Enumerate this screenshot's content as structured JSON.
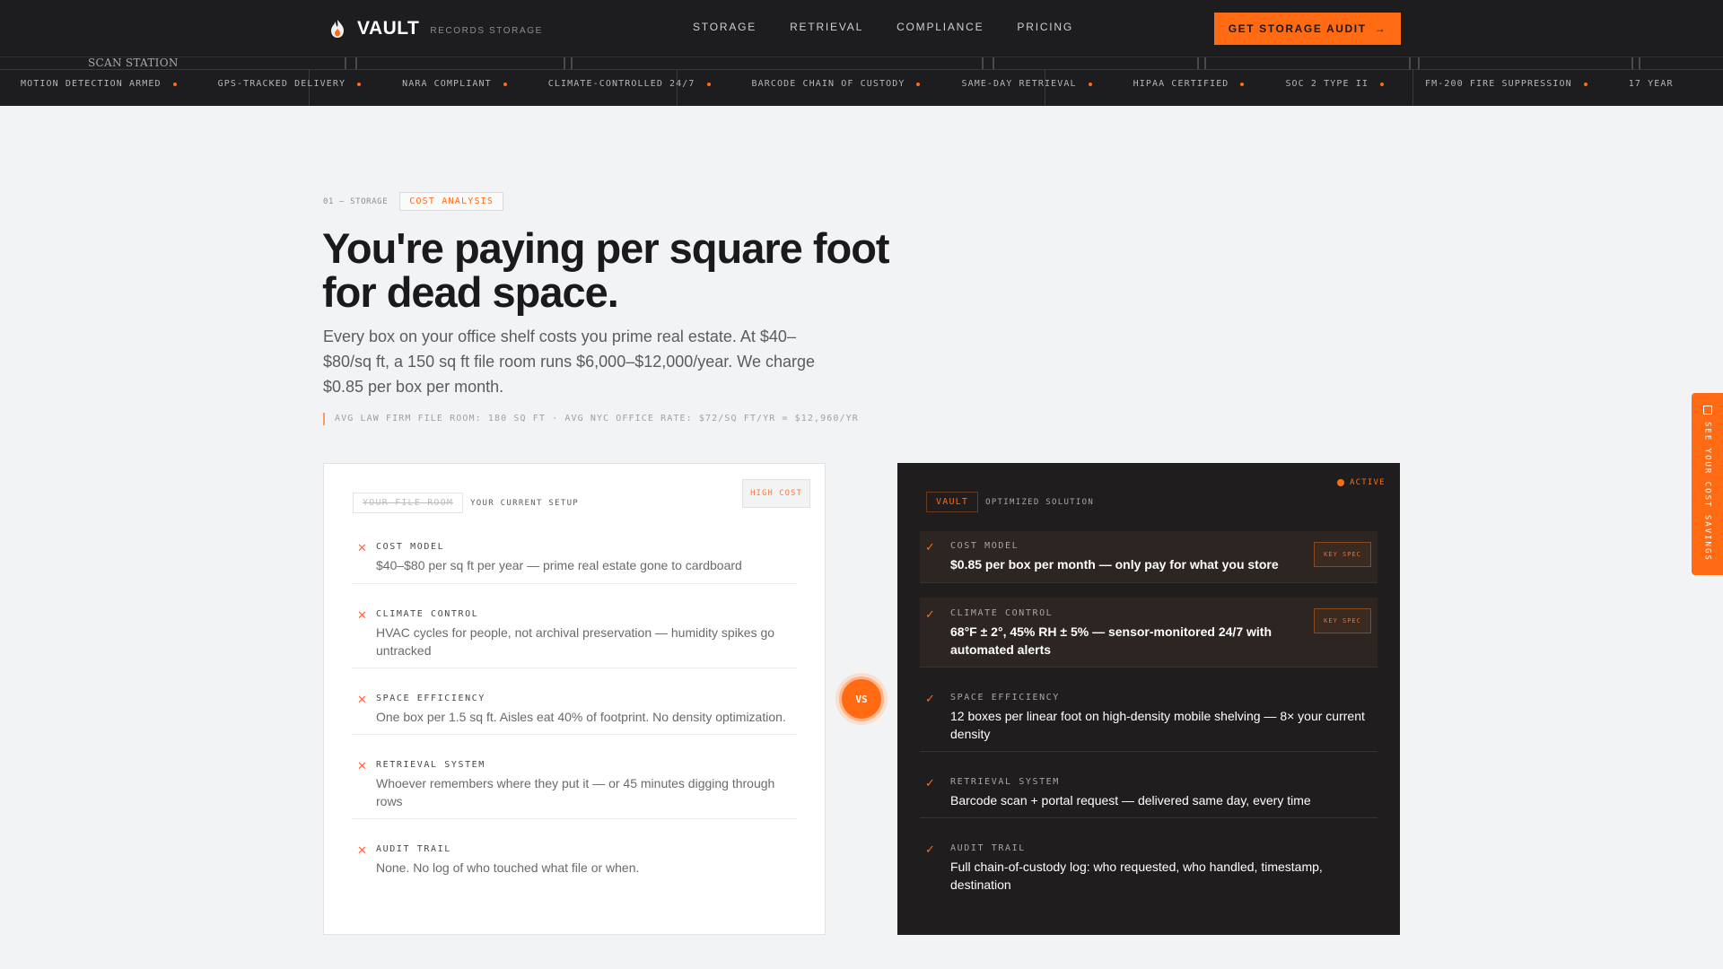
{
  "nav": {
    "logo_text": "VAULT",
    "logo_sub": "RECORDS STORAGE",
    "links": [
      "STORAGE",
      "RETRIEVAL",
      "COMPLIANCE",
      "PRICING"
    ],
    "cta_label": "GET STORAGE AUDIT",
    "cta_arrow": "→",
    "accent": "#ff6a13"
  },
  "ticker": {
    "scan_label": "SCAN STATION",
    "items": [
      "MOTION DETECTION ARMED",
      "GPS-TRACKED DELIVERY",
      "NARA COMPLIANT",
      "CLIMATE-CONTROLLED 24/7",
      "BARCODE CHAIN OF CUSTODY",
      "SAME-DAY RETRIEVAL",
      "HIPAA CERTIFIED",
      "SOC 2 TYPE II",
      "FM-200 FIRE SUPPRESSION",
      "17 YEAR"
    ]
  },
  "hero": {
    "section": "01 — STORAGE",
    "tag": "COST ANALYSIS",
    "title_line1": "You're paying per square foot",
    "title_line2": "for dead space.",
    "lead": "Every box on your office shelf costs you prime real estate. At $40–$80/sq ft, a 150 sq ft file room runs $6,000–$12,000/year. We charge $0.85 per box per month.",
    "stat": "AVG LAW FIRM FILE ROOM: 180 SQ FT · AVG NYC OFFICE RATE: $72/SQ FT/YR = $12,960/YR"
  },
  "left_card": {
    "pill": "YOUR FILE ROOM",
    "sub": "YOUR CURRENT SETUP",
    "badge": "HIGH COST",
    "icon": "✕",
    "rows": [
      {
        "label": "COST MODEL",
        "value": "$40–$80 per sq ft per year — prime real estate gone to cardboard"
      },
      {
        "label": "CLIMATE CONTROL",
        "value": "HVAC cycles for people, not archival preservation — humidity spikes go untracked"
      },
      {
        "label": "SPACE EFFICIENCY",
        "value": "One box per 1.5 sq ft. Aisles eat 40% of footprint. No density optimization."
      },
      {
        "label": "RETRIEVAL SYSTEM",
        "value": "Whoever remembers where they put it — or 45 minutes digging through rows"
      },
      {
        "label": "AUDIT TRAIL",
        "value": "None. No log of who touched what file or when."
      }
    ]
  },
  "vs_label": "VS",
  "right_card": {
    "pill": "VAULT",
    "sub": "OPTIMIZED SOLUTION",
    "active": "ACTIVE",
    "icon": "✓",
    "key_label": "KEY SPEC",
    "rows": [
      {
        "label": "COST MODEL",
        "value": "$0.85 per box per month — only pay for what you store"
      },
      {
        "label": "CLIMATE CONTROL",
        "value": "68°F ± 2°, 45% RH ± 5% — sensor-monitored 24/7 with automated alerts"
      },
      {
        "label": "SPACE EFFICIENCY",
        "value": "12 boxes per linear foot on high-density mobile shelving — 8× your current density"
      },
      {
        "label": "RETRIEVAL SYSTEM",
        "value": "Barcode scan + portal request — delivered same day, every time"
      },
      {
        "label": "AUDIT TRAIL",
        "value": "Full chain-of-custody log: who requested, who handled, timestamp, destination"
      }
    ]
  },
  "side_tab": "SEE YOUR COST SAVINGS"
}
